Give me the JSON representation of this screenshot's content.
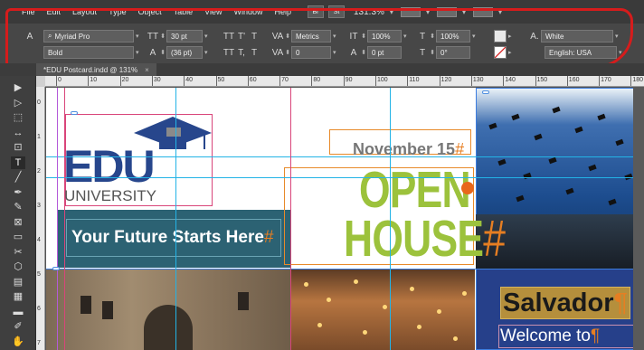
{
  "menubar": {
    "items": [
      "File",
      "Edit",
      "Layout",
      "Type",
      "Object",
      "Table",
      "View",
      "Window",
      "Help"
    ],
    "bridge_label": "Br",
    "stock_label": "St",
    "zoom": "131.3%"
  },
  "control": {
    "font_family": "Myriad Pro",
    "font_style": "Bold",
    "font_size": "30 pt",
    "leading": "(36 pt)",
    "kerning": "Metrics",
    "tracking": "0",
    "vertical_scale": "100%",
    "horizontal_scale": "100%",
    "baseline_shift": "0 pt",
    "skew": "0°",
    "fill_color_name": "White",
    "language": "English: USA",
    "char_a_label": "A.",
    "small_icons": {
      "size": "TT",
      "caps": "TT",
      "super": "T'",
      "italic_t": "T",
      "tracking_label": "VA",
      "strike": "T",
      "sub": "T,",
      "underline": "T",
      "va_kern": "VA",
      "scale_v": "IT",
      "scale_h": "T",
      "baseline": "A",
      "skew_t": "T"
    }
  },
  "document_tab": {
    "title": "*EDU Postcard.indd @ 131%",
    "close": "×"
  },
  "ruler": {
    "top_marks": [
      "0",
      "10",
      "20",
      "30",
      "40",
      "50",
      "60",
      "70",
      "80",
      "90",
      "100",
      "110",
      "120",
      "130",
      "140",
      "150",
      "160",
      "170",
      "180"
    ],
    "left_marks": [
      "0",
      "1",
      "2",
      "3",
      "4",
      "5",
      "6",
      "7"
    ]
  },
  "tools": [
    "selection-tool",
    "direct-selection-tool",
    "page-tool",
    "gap-tool",
    "content-collector-tool",
    "type-tool",
    "line-tool",
    "pen-tool",
    "pencil-tool",
    "rectangle-frame-tool",
    "rectangle-tool",
    "scissors-tool",
    "free-transform-tool",
    "gradient-swatch-tool",
    "gradient-feather-tool",
    "note-tool",
    "eyedropper-tool",
    "hand-tool"
  ],
  "tool_glyphs": [
    "▶",
    "▷",
    "⬚",
    "↔",
    "⊡",
    "T",
    "╱",
    "✒",
    "✎",
    "⊠",
    "▭",
    "✂",
    "⬡",
    "▤",
    "▦",
    "▬",
    "✐",
    "✋"
  ],
  "canvas": {
    "edu_letters": "EDU",
    "university": "UNIVERSITY",
    "tagline": "Your Future Starts Here",
    "tagline_mark": "#",
    "date_line": "November 15",
    "date_mark": "#",
    "open_word": "OPEN",
    "house_word": "HOUSE",
    "house_mark": "#",
    "city": "Salvador",
    "city_mark": "¶",
    "welcome": "Welcome to",
    "welcome_mark": "¶"
  },
  "colors": {
    "highlight": "#d61c1c",
    "edu_blue": "#27468c",
    "teal": "#2c6273",
    "open_green": "#9cc23c",
    "salvador_gold": "#b58f3c",
    "guide_cyan": "#23b3e6"
  }
}
